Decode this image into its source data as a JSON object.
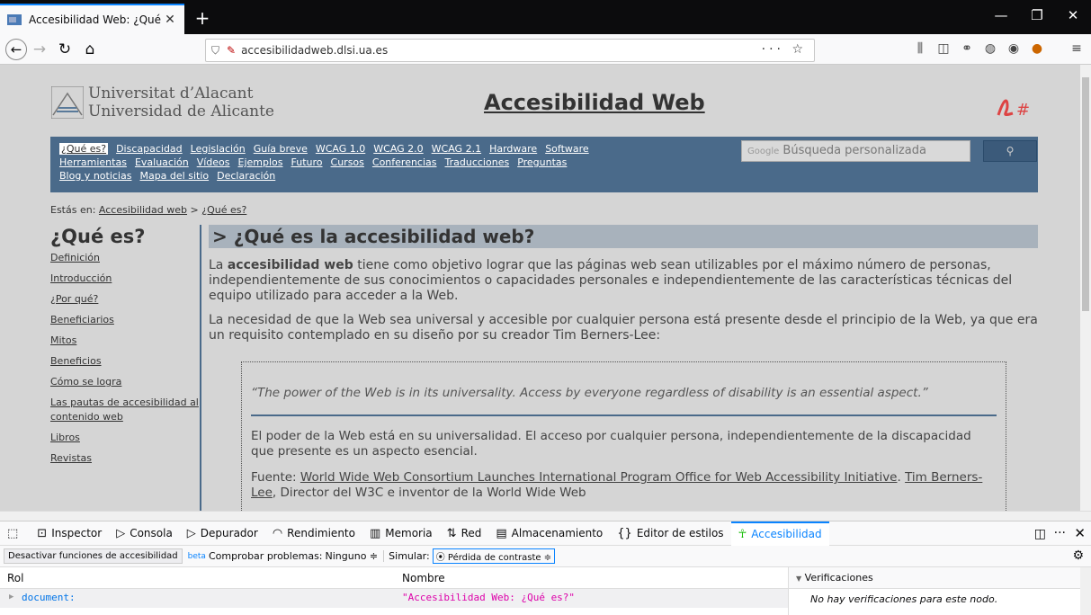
{
  "browser": {
    "tab_title": "Accesibilidad Web: ¿Qué es?",
    "tab_close": "✕",
    "new_tab": "+",
    "url": "accesibilidadweb.dlsi.ua.es",
    "url_bold_part": "ua.es",
    "page_actions": "··· ☆"
  },
  "site": {
    "uni_line1": "Universitat d’Alacant",
    "uni_line2": "Universidad de Alicante",
    "title": "Accesibilidad Web",
    "search_placeholder": "Búsqueda personalizada",
    "search_brand": "Google",
    "search_button": "⚲",
    "menu_row1": [
      "¿Qué es?",
      "Discapacidad",
      "Legislación",
      "Guía breve",
      "WCAG 1.0",
      "WCAG 2.0",
      "WCAG 2.1",
      "Hardware",
      "Software"
    ],
    "menu_row2": [
      "Herramientas",
      "Evaluación",
      "Vídeos",
      "Ejemplos",
      "Futuro",
      "Cursos",
      "Conferencias",
      "Traducciones",
      "Preguntas"
    ],
    "menu_row3": [
      "Blog y noticias",
      "Mapa del sitio",
      "Declaración"
    ],
    "breadcrumb_prefix": "Estás en:",
    "breadcrumb_home": "Accesibilidad web",
    "breadcrumb_sep": ">",
    "breadcrumb_current": "¿Qué es?"
  },
  "sidebar": {
    "heading": "¿Qué es?",
    "items": [
      "Definición",
      "Introducción",
      "¿Por qué?",
      "Beneficiarios",
      "Mitos",
      "Beneficios",
      "Cómo se logra",
      "Las pautas de accesibilidad al contenido web",
      "Libros",
      "Revistas"
    ]
  },
  "main": {
    "heading": "> ¿Qué es la accesibilidad web?",
    "p1_pre": "La ",
    "p1_bold": "accesibilidad web",
    "p1_post": " tiene como objetivo lograr que las páginas web sean utilizables por el máximo número de personas, independientemente de sus conocimientos o capacidades personales e independientemente de las características técnicas del equipo utilizado para acceder a la Web.",
    "p2": "La necesidad de que la Web sea universal y accesible por cualquier persona está presente desde el principio de la Web, ya que era un requisito contemplado en su diseño por su creador Tim Berners-Lee:",
    "quote_en": "“The power of the Web is in its universality. Access by everyone regardless of disability is an essential aspect.”",
    "quote_es": "El poder de la Web está en su universalidad. El acceso por cualquier persona, independientemente de la discapacidad que presente es un aspecto esencial.",
    "source_label": "Fuente: ",
    "source_link": "World Wide Web Consortium Launches International Program Office for Web Accessibility Initiative",
    "source_author_link": "Tim Berners-Lee",
    "source_post": ", Director del W3C e inventor de la World Wide Web"
  },
  "devtools": {
    "tabs": [
      {
        "icon": "⊡",
        "label": "Inspector"
      },
      {
        "icon": "▷",
        "label": "Consola"
      },
      {
        "icon": "▷",
        "label": "Depurador"
      },
      {
        "icon": "◠",
        "label": "Rendimiento"
      },
      {
        "icon": "▥",
        "label": "Memoria"
      },
      {
        "icon": "⇅",
        "label": "Red"
      },
      {
        "icon": "▤",
        "label": "Almacenamiento"
      },
      {
        "icon": "{}",
        "label": "Editor de estilos"
      },
      {
        "icon": "☥",
        "label": "Accesibilidad"
      }
    ],
    "deactivate": "Desactivar funciones de accesibilidad",
    "beta": "beta",
    "check_label": "Comprobar problemas:",
    "check_value": "Ninguno ≑",
    "simulate_label": "Simular:",
    "simulate_value": "⦿ Pérdida de contraste ≑",
    "col_role": "Rol",
    "col_name": "Nombre",
    "row_role": "document:",
    "row_name": "\"Accesibilidad Web: ¿Qué es?\"",
    "checks_title": "Verificaciones",
    "checks_empty": "No hay verificaciones para este nodo."
  },
  "colors": {
    "accent": "#0a84ff",
    "menu_bg": "#4a6a8a",
    "heading_bg": "#a8b2bc",
    "page_bg": "#d5d5d5"
  }
}
